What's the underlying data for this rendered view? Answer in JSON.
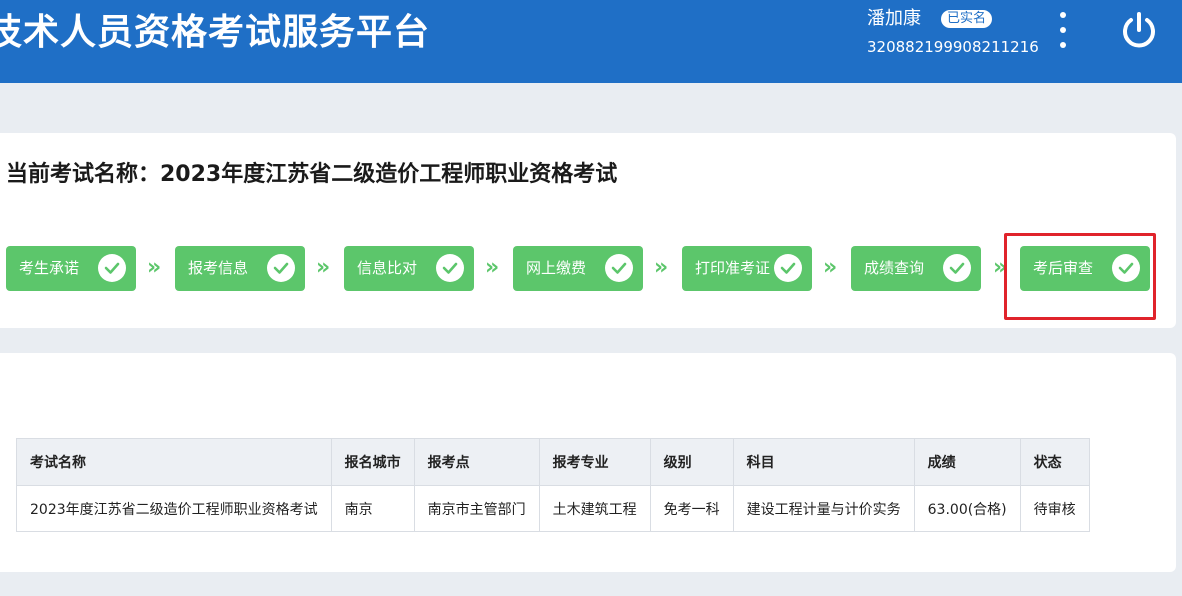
{
  "header": {
    "title": "技术人员资格考试服务平台",
    "user_name": "潘加康",
    "verified_badge": "已实名",
    "user_id": "320882199908211216",
    "more_icon": "more-vertical-icon",
    "power_icon": "power-icon"
  },
  "exam": {
    "title": "当前考试名称：2023年度江苏省二级造价工程师职业资格考试"
  },
  "steps": [
    {
      "label": "考生承诺",
      "status": "done"
    },
    {
      "label": "报考信息",
      "status": "done"
    },
    {
      "label": "信息比对",
      "status": "done"
    },
    {
      "label": "网上缴费",
      "status": "done"
    },
    {
      "label": "打印准考证",
      "status": "done"
    },
    {
      "label": "成绩查询",
      "status": "done"
    },
    {
      "label": "考后审查",
      "status": "done"
    }
  ],
  "arrow_glyph": "»",
  "table": {
    "headers": [
      "考试名称",
      "报名城市",
      "报考点",
      "报考专业",
      "级别",
      "科目",
      "成绩",
      "状态"
    ],
    "rows": [
      [
        "2023年度江苏省二级造价工程师职业资格考试",
        "南京",
        "南京市主管部门",
        "土木建筑工程",
        "免考一科",
        "建设工程计量与计价实务",
        "63.00(合格)",
        "待审核"
      ]
    ]
  },
  "colors": {
    "header_bg": "#1f6fc6",
    "step_green": "#5cc66b",
    "highlight_red": "#e0232b"
  }
}
